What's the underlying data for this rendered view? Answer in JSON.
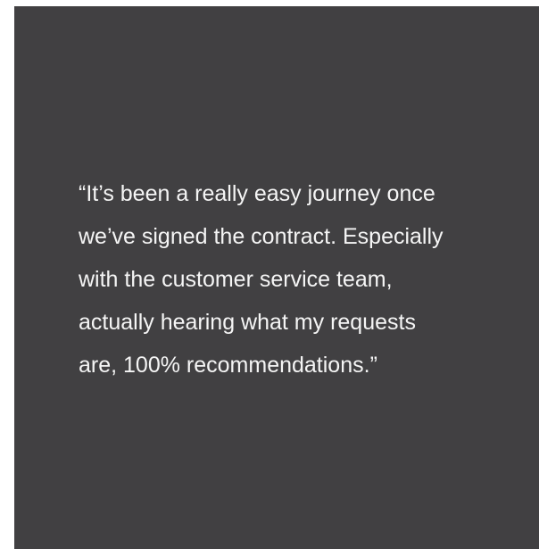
{
  "testimonial": {
    "lines": [
      "“It’s been a really easy journey once",
      "we’ve signed the contract. Especially",
      "with the customer service team,",
      "actually hearing what my requests",
      "are, 100% recommendations.”"
    ]
  },
  "colors": {
    "card_background": "#414042",
    "text": "#f5f5f5",
    "page_background": "#ffffff"
  }
}
